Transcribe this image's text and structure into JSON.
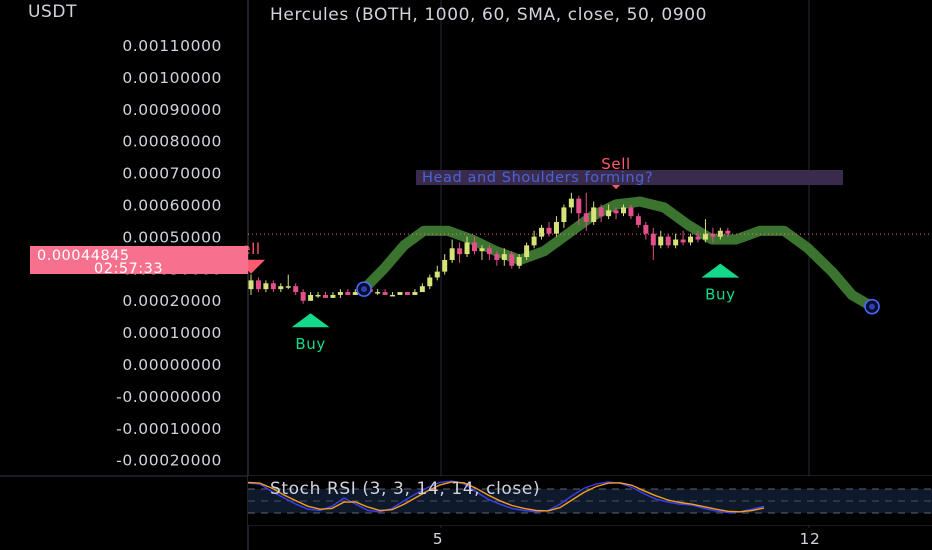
{
  "chart_data": {
    "type": "candlestick",
    "y_axis": {
      "currency": "USDT",
      "ticks": [
        "0.00110000",
        "0.00100000",
        "0.00090000",
        "0.00080000",
        "0.00070000",
        "0.00060000",
        "0.00050000",
        "0.00030000",
        "0.00020000",
        "0.00010000",
        "0.00000000",
        "-0.00000000",
        "-0.00010000",
        "-0.00020000"
      ],
      "ylim": [
        -0.0002,
        0.0011
      ]
    },
    "x_axis": {
      "ticks": [
        "5",
        "12"
      ]
    },
    "indicator_title": "Hercules (BOTH, 1000, 60, SMA, close, 50, 0900",
    "current_price": {
      "value": "0.00044845",
      "countdown": "02:57:33",
      "color": "#f7718f"
    },
    "colors": {
      "bull": "#d7e27a",
      "bear": "#e2508a",
      "band": "#3e7a32",
      "buy": "#14d98a",
      "sell": "#ff5a6e",
      "note_bg": "#3a2b4d",
      "note_text": "#4a63d9"
    },
    "annotation": "Head and Shoulders forming?",
    "signals": [
      {
        "type": "sell",
        "label": "ell",
        "x": 0,
        "y": 0.00034
      },
      {
        "type": "buy",
        "label": "Buy",
        "x": 8,
        "y": 0.00015
      },
      {
        "type": "sell",
        "label": "Sell",
        "x": 49,
        "y": 0.00063
      },
      {
        "type": "buy",
        "label": "Buy",
        "x": 63,
        "y": 0.00032
      }
    ],
    "candles": [
      {
        "o": 0.00026,
        "c": 0.00029,
        "h": 0.00031,
        "l": 0.00024
      },
      {
        "o": 0.00029,
        "c": 0.00026,
        "h": 0.0003,
        "l": 0.00025
      },
      {
        "o": 0.00026,
        "c": 0.00028,
        "h": 0.00029,
        "l": 0.00025
      },
      {
        "o": 0.00028,
        "c": 0.00026,
        "h": 0.00029,
        "l": 0.00025
      },
      {
        "o": 0.00026,
        "c": 0.00027,
        "h": 0.00028,
        "l": 0.00025
      },
      {
        "o": 0.00027,
        "c": 0.00027,
        "h": 0.00031,
        "l": 0.00026
      },
      {
        "o": 0.00027,
        "c": 0.00025,
        "h": 0.00028,
        "l": 0.00024
      },
      {
        "o": 0.00025,
        "c": 0.00022,
        "h": 0.00026,
        "l": 0.00021
      },
      {
        "o": 0.00022,
        "c": 0.00024,
        "h": 0.00025,
        "l": 0.00022
      },
      {
        "o": 0.00024,
        "c": 0.00024,
        "h": 0.00025,
        "l": 0.00023
      },
      {
        "o": 0.00024,
        "c": 0.00023,
        "h": 0.00025,
        "l": 0.00023
      },
      {
        "o": 0.00023,
        "c": 0.00024,
        "h": 0.00025,
        "l": 0.00023
      },
      {
        "o": 0.00024,
        "c": 0.00025,
        "h": 0.00026,
        "l": 0.00023
      },
      {
        "o": 0.00025,
        "c": 0.00024,
        "h": 0.00026,
        "l": 0.00024
      },
      {
        "o": 0.00024,
        "c": 0.00025,
        "h": 0.00026,
        "l": 0.00024
      },
      {
        "o": 0.00025,
        "c": 0.00026,
        "h": 0.00027,
        "l": 0.00025
      },
      {
        "o": 0.00026,
        "c": 0.00025,
        "h": 0.00027,
        "l": 0.00025
      },
      {
        "o": 0.00025,
        "c": 0.00025,
        "h": 0.00026,
        "l": 0.00024
      },
      {
        "o": 0.00025,
        "c": 0.00024,
        "h": 0.00026,
        "l": 0.00024
      },
      {
        "o": 0.00024,
        "c": 0.00024,
        "h": 0.00025,
        "l": 0.00024
      },
      {
        "o": 0.00024,
        "c": 0.00025,
        "h": 0.00025,
        "l": 0.00024
      },
      {
        "o": 0.00025,
        "c": 0.00024,
        "h": 0.00025,
        "l": 0.00024
      },
      {
        "o": 0.00024,
        "c": 0.00025,
        "h": 0.00026,
        "l": 0.00024
      },
      {
        "o": 0.00025,
        "c": 0.00027,
        "h": 0.00028,
        "l": 0.00025
      },
      {
        "o": 0.00027,
        "c": 0.0003,
        "h": 0.00031,
        "l": 0.00026
      },
      {
        "o": 0.0003,
        "c": 0.00032,
        "h": 0.00034,
        "l": 0.00029
      },
      {
        "o": 0.00032,
        "c": 0.00036,
        "h": 0.00038,
        "l": 0.00031
      },
      {
        "o": 0.00036,
        "c": 0.0004,
        "h": 0.00043,
        "l": 0.00035
      },
      {
        "o": 0.0004,
        "c": 0.00038,
        "h": 0.00042,
        "l": 0.00035
      },
      {
        "o": 0.00038,
        "c": 0.00042,
        "h": 0.00044,
        "l": 0.00037
      },
      {
        "o": 0.00042,
        "c": 0.00039,
        "h": 0.00044,
        "l": 0.00038
      },
      {
        "o": 0.00039,
        "c": 0.0004,
        "h": 0.00041,
        "l": 0.00036
      },
      {
        "o": 0.0004,
        "c": 0.00038,
        "h": 0.00041,
        "l": 0.00036
      },
      {
        "o": 0.00038,
        "c": 0.00036,
        "h": 0.00039,
        "l": 0.00034
      },
      {
        "o": 0.00036,
        "c": 0.00038,
        "h": 0.0004,
        "l": 0.00034
      },
      {
        "o": 0.00038,
        "c": 0.00034,
        "h": 0.00039,
        "l": 0.00033
      },
      {
        "o": 0.00034,
        "c": 0.00037,
        "h": 0.00038,
        "l": 0.00033
      },
      {
        "o": 0.00037,
        "c": 0.00041,
        "h": 0.00042,
        "l": 0.00036
      },
      {
        "o": 0.00041,
        "c": 0.00044,
        "h": 0.00046,
        "l": 0.0004
      },
      {
        "o": 0.00044,
        "c": 0.00047,
        "h": 0.00048,
        "l": 0.00043
      },
      {
        "o": 0.00047,
        "c": 0.00045,
        "h": 0.00049,
        "l": 0.00044
      },
      {
        "o": 0.00045,
        "c": 0.00049,
        "h": 0.00051,
        "l": 0.00044
      },
      {
        "o": 0.00049,
        "c": 0.00054,
        "h": 0.00055,
        "l": 0.00047
      },
      {
        "o": 0.00054,
        "c": 0.00057,
        "h": 0.00059,
        "l": 0.00052
      },
      {
        "o": 0.00057,
        "c": 0.00052,
        "h": 0.00058,
        "l": 0.00048
      },
      {
        "o": 0.00052,
        "c": 0.00049,
        "h": 0.00059,
        "l": 0.00046
      },
      {
        "o": 0.00049,
        "c": 0.00054,
        "h": 0.00056,
        "l": 0.00048
      },
      {
        "o": 0.00054,
        "c": 0.00051,
        "h": 0.00055,
        "l": 0.00049
      },
      {
        "o": 0.00051,
        "c": 0.00053,
        "h": 0.00055,
        "l": 0.0005
      },
      {
        "o": 0.00053,
        "c": 0.00052,
        "h": 0.00054,
        "l": 0.0005
      },
      {
        "o": 0.00052,
        "c": 0.00054,
        "h": 0.00055,
        "l": 0.00051
      },
      {
        "o": 0.00054,
        "c": 0.00051,
        "h": 0.00055,
        "l": 0.0005
      },
      {
        "o": 0.00051,
        "c": 0.00048,
        "h": 0.00052,
        "l": 0.00047
      },
      {
        "o": 0.00048,
        "c": 0.00045,
        "h": 0.00049,
        "l": 0.00043
      },
      {
        "o": 0.00045,
        "c": 0.00041,
        "h": 0.00047,
        "l": 0.00036
      },
      {
        "o": 0.00041,
        "c": 0.00044,
        "h": 0.00046,
        "l": 0.0004
      },
      {
        "o": 0.00044,
        "c": 0.00041,
        "h": 0.00045,
        "l": 0.0004
      },
      {
        "o": 0.00041,
        "c": 0.00043,
        "h": 0.00045,
        "l": 0.0004
      },
      {
        "o": 0.00043,
        "c": 0.00042,
        "h": 0.00046,
        "l": 0.00041
      },
      {
        "o": 0.00042,
        "c": 0.00044,
        "h": 0.00045,
        "l": 0.00041
      },
      {
        "o": 0.00044,
        "c": 0.00043,
        "h": 0.00046,
        "l": 0.00042
      },
      {
        "o": 0.00043,
        "c": 0.00045,
        "h": 0.0005,
        "l": 0.00042
      },
      {
        "o": 0.00045,
        "c": 0.00044,
        "h": 0.00047,
        "l": 0.00042
      },
      {
        "o": 0.00044,
        "c": 0.00046,
        "h": 0.00047,
        "l": 0.00043
      },
      {
        "o": 0.00046,
        "c": 0.00045,
        "h": 0.00047,
        "l": 0.00044
      }
    ],
    "band_center": [
      [
        29,
        0.00026
      ],
      [
        34,
        0.00033
      ],
      [
        39,
        0.00041
      ],
      [
        44,
        0.00046
      ],
      [
        50,
        0.00046
      ],
      [
        56,
        0.00043
      ],
      [
        62,
        0.00039
      ],
      [
        68,
        0.00036
      ],
      [
        74,
        0.00039
      ],
      [
        80,
        0.00045
      ],
      [
        86,
        0.00051
      ],
      [
        92,
        0.00055
      ],
      [
        98,
        0.00056
      ],
      [
        104,
        0.00054
      ],
      [
        110,
        0.00048
      ],
      [
        116,
        0.00043
      ],
      [
        122,
        0.00043
      ],
      [
        128,
        0.00046
      ],
      [
        134,
        0.00046
      ],
      [
        140,
        0.0004
      ],
      [
        146,
        0.00032
      ],
      [
        151,
        0.00024
      ],
      [
        156,
        0.0002
      ]
    ],
    "band_width": 3.5e-05,
    "markers": [
      {
        "x": 29,
        "y": 0.00026
      },
      {
        "x": 156,
        "y": 0.0002
      }
    ],
    "lower_panel": {
      "title": "Stoch RSI (3, 3, 14, 14, close)",
      "k": [
        90,
        88,
        70,
        55,
        40,
        28,
        25,
        35,
        55,
        40,
        25,
        22,
        30,
        48,
        65,
        80,
        92,
        95,
        88,
        70,
        52,
        40,
        30,
        25,
        22,
        25,
        40,
        60,
        78,
        88,
        93,
        90,
        80,
        65,
        52,
        45,
        40,
        38,
        30,
        24,
        20,
        22,
        28,
        35
      ],
      "d": [
        92,
        90,
        78,
        62,
        48,
        35,
        28,
        30,
        45,
        45,
        33,
        25,
        27,
        40,
        56,
        72,
        86,
        93,
        91,
        78,
        62,
        48,
        37,
        30,
        25,
        24,
        32,
        50,
        68,
        82,
        90,
        91,
        85,
        72,
        60,
        50,
        44,
        40,
        34,
        28,
        23,
        22,
        25,
        31
      ],
      "k_color": "#3b3ff0",
      "d_color": "#f59e20"
    }
  }
}
